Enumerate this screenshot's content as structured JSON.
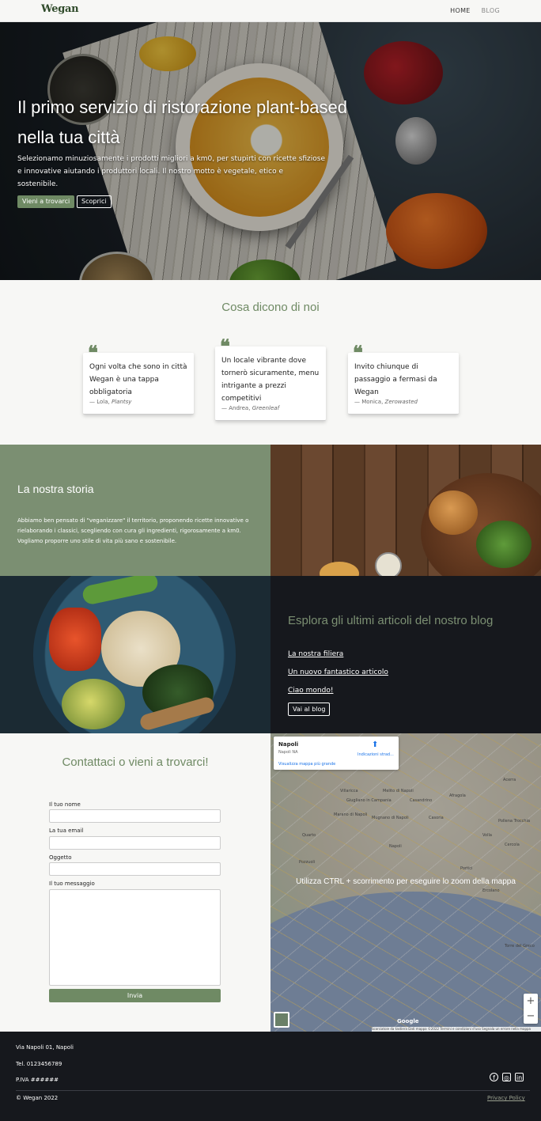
{
  "nav": {
    "logo": "Wegan",
    "links": [
      "HOME",
      "BLOG"
    ]
  },
  "hero": {
    "title": "Il primo servizio di ristorazione plant-based nella tua città",
    "subtitle": "Selezionamo minuziosamente i prodotti migliori a km0, per stupirti con ricette sfiziose e innovative aiutando i produttori locali. Il nostro motto è vegetale, etico e sostenibile.",
    "cta_primary": "Vieni a trovarci",
    "cta_secondary": "Scoprici"
  },
  "testimonials": {
    "title": "Cosa dicono di noi",
    "items": [
      {
        "text": "Ogni volta che sono in città Wegan è una tappa obbligatoria",
        "author": "— Lola,",
        "source": "Plantsy"
      },
      {
        "text": "Un locale vibrante dove tornerò sicuramente, menu intrigante a prezzi competitivi",
        "author": "— Andrea,",
        "source": "Greenleaf"
      },
      {
        "text": "Invito chiunque di passaggio a fermasi da Wegan",
        "author": "— Monica,",
        "source": "Zerowasted"
      }
    ]
  },
  "story": {
    "title": "La nostra storia",
    "text": "Abbiamo ben pensato di \"veganizzare\" il territorio, proponendo ricette innovative o rielaborando i classici, scegliendo con cura gli ingredienti, rigorosamente a km0. Vogliamo proporre uno stile di vita più sano e sostenibile."
  },
  "blog": {
    "title": "Esplora gli ultimi articoli del nostro blog",
    "links": [
      "La nostra filiera",
      "Un nuovo fantastico articolo",
      "Ciao mondo!"
    ],
    "button": "Vai al blog"
  },
  "contact": {
    "title": "Contattaci o vieni a trovarci!",
    "name_label": "Il tuo nome",
    "email_label": "La tua email",
    "subject_label": "Oggetto",
    "message_label": "Il tuo messaggio",
    "submit": "Invia"
  },
  "map": {
    "place_name": "Napoli",
    "place_sub": "Napoli NA",
    "directions": "Indicazioni strad...",
    "bigger_map": "Visualizza mappa più grande",
    "hint": "Utilizza CTRL + scorrimento per eseguire lo zoom della mappa",
    "footer": "Scorciatoie da tastiera   Dati mappa ©2022   Termini e condizioni d'uso   Segnala un errore nella mappa",
    "google": "Google",
    "places": [
      "Villaricca",
      "Giugliano in Campania",
      "Melito di Napoli",
      "Casandrino",
      "Marano di Napoli",
      "Mugnano di Napoli",
      "Afragola",
      "Casoria",
      "Quarto",
      "Napoli",
      "Portici",
      "Pozzuoli",
      "Ercolano",
      "Torre del Greco",
      "Volla",
      "Cercola",
      "Pollena Trocchia",
      "Acerra"
    ]
  },
  "footer": {
    "address": "Via Napoli 01, Napoli",
    "phone": "Tel. 0123456789",
    "vat": "P.IVA ######",
    "copyright": "© Wegan 2022",
    "privacy": "Privacy Policy"
  }
}
